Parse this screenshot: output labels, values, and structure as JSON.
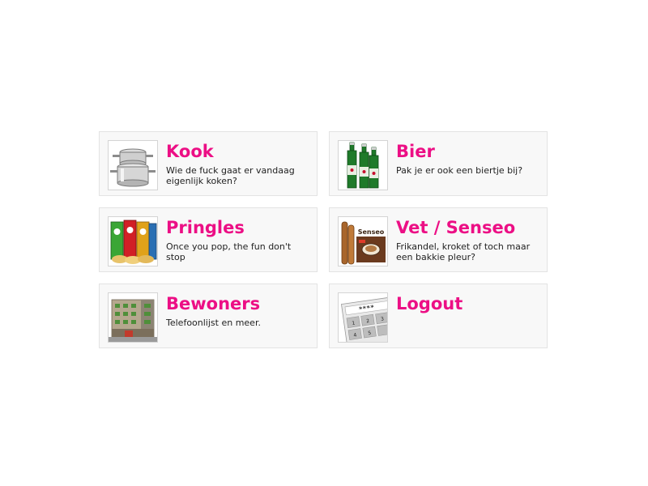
{
  "tiles": [
    {
      "title": "Kook",
      "description": "Wie de fuck gaat er vandaag eigenlijk koken?",
      "image": "cooking-pots-image"
    },
    {
      "title": "Bier",
      "description": "Pak je er ook een biertje bij?",
      "image": "beer-bottles-image"
    },
    {
      "title": "Pringles",
      "description": "Once you pop, the fun don't stop",
      "image": "pringles-cans-image"
    },
    {
      "title": "Vet / Senseo",
      "description": "Frikandel, kroket of toch maar een bakkie pleur?",
      "image": "snacks-senseo-image"
    },
    {
      "title": "Bewoners",
      "description": "Telefoonlijst en meer.",
      "image": "apartment-building-image"
    },
    {
      "title": "Logout",
      "description": "",
      "image": "password-keypad-image"
    }
  ],
  "colors": {
    "title": "#ec0f85",
    "card_background": "#f8f8f8",
    "card_border": "#e3e3e3",
    "text": "#222222"
  }
}
